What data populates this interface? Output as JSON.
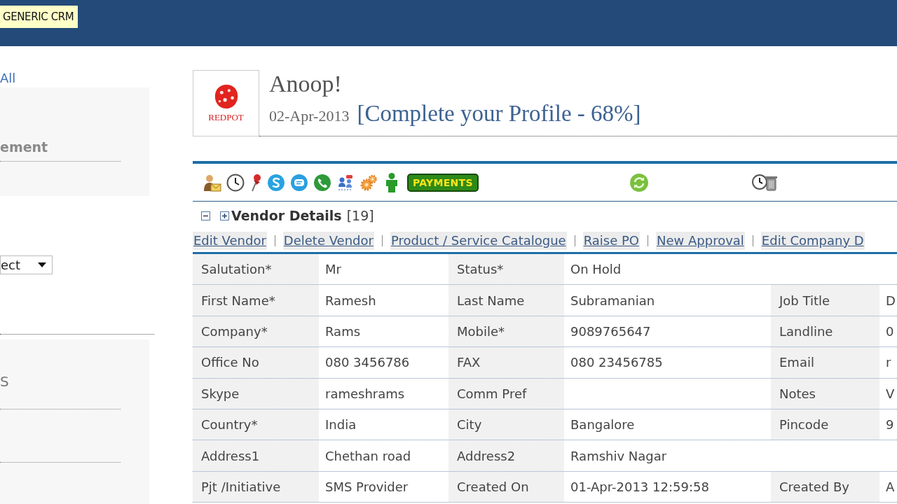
{
  "header": {
    "brand": "GENERIC CRM"
  },
  "sidebar": {
    "link": "All",
    "panel_title": "ement",
    "select": {
      "value": "ect"
    },
    "section_title": "S"
  },
  "profile": {
    "logo_text": "REDPOT",
    "greeting": "Anoop!",
    "date": "02-Apr-2013",
    "profile_link": "[Complete your Profile - 68%]"
  },
  "toolbar": {
    "payments_button": "PAYMENTS"
  },
  "section": {
    "title": "Vendor Details",
    "count": "[19]"
  },
  "actions": [
    "Edit Vendor",
    "Delete Vendor",
    "Product / Service Catalogue",
    "Raise PO",
    "New Approval",
    "Edit Company D"
  ],
  "table": {
    "rows": [
      [
        {
          "label": "Salutation*",
          "value": "Mr"
        },
        {
          "label": "Status*",
          "value": "On Hold"
        }
      ],
      [
        {
          "label": "First Name*",
          "value": "Ramesh"
        },
        {
          "label": "Last Name",
          "value": "Subramanian"
        },
        {
          "label": "Job Title",
          "value": "D"
        }
      ],
      [
        {
          "label": "Company*",
          "value": "Rams"
        },
        {
          "label": "Mobile*",
          "value": "9089765647"
        },
        {
          "label": "Landline",
          "value": "0"
        }
      ],
      [
        {
          "label": "Office No",
          "value": "080 3456786"
        },
        {
          "label": "FAX",
          "value": "080 23456785"
        },
        {
          "label": "Email",
          "value": "r"
        }
      ],
      [
        {
          "label": "Skype",
          "value": "rameshrams"
        },
        {
          "label": "Comm Pref"
        },
        {
          "label": "Notes",
          "value": "V"
        }
      ],
      [
        {
          "label": "Country*",
          "value": "India"
        },
        {
          "label": "City",
          "value": "Bangalore"
        },
        {
          "label": "Pincode",
          "value": "9"
        }
      ],
      [
        {
          "label": "Address1",
          "value": "Chethan road"
        },
        {
          "label": "Address2",
          "value": "Ramshiv Nagar"
        }
      ],
      [
        {
          "label": "Pjt /Initiative",
          "value": "SMS Provider"
        },
        {
          "label": "Created On",
          "value": "01-Apr-2013 12:59:58"
        },
        {
          "label": "Created By",
          "value": "A"
        }
      ]
    ]
  }
}
